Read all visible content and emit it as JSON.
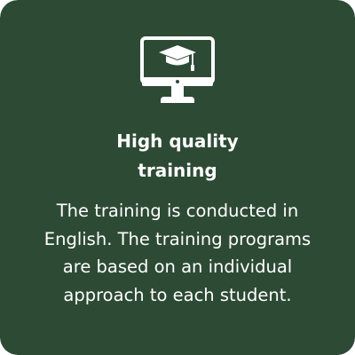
{
  "card": {
    "background_color": "#2d4a35",
    "icon": "monitor-graduation-cap-icon",
    "title_line1": "High quality",
    "title_line2": "training",
    "description": "The training is conducted in English. The training programs are based on an individual approach to each student."
  }
}
